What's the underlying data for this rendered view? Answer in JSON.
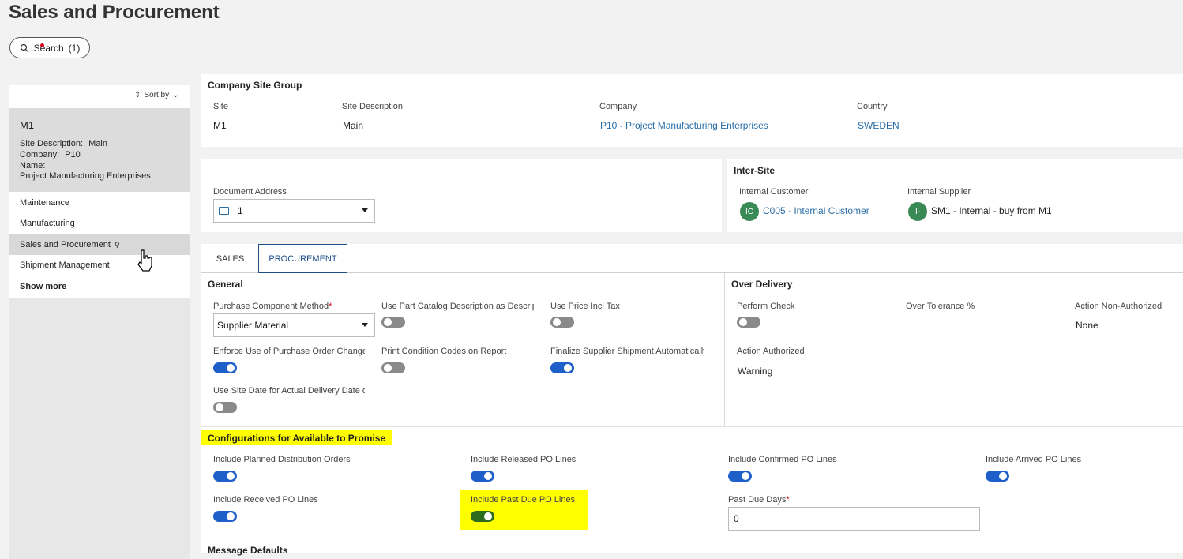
{
  "page": {
    "title": "Sales and Procurement"
  },
  "search": {
    "label": "Search",
    "count": "(1)"
  },
  "sidebar": {
    "sort_label": "Sort by",
    "selected": {
      "code": "M1",
      "site_description_label": "Site Description:",
      "site_description": "Main",
      "company_label": "Company:",
      "company": "P10",
      "name_label": "Name:",
      "name": "Project Manufacturing Enterprises"
    },
    "items": [
      {
        "label": "Maintenance"
      },
      {
        "label": "Manufacturing"
      },
      {
        "label": "Sales and Procurement"
      },
      {
        "label": "Shipment Management"
      }
    ],
    "show_more": "Show more"
  },
  "company_site_group": {
    "title": "Company Site Group",
    "site_label": "Site",
    "site": "M1",
    "site_desc_label": "Site Description",
    "site_desc": "Main",
    "company_label": "Company",
    "company": "P10 - Project Manufacturing Enterprises",
    "country_label": "Country",
    "country": "SWEDEN"
  },
  "document_address": {
    "label": "Document Address",
    "value": "1"
  },
  "inter_site": {
    "title": "Inter-Site",
    "customer_label": "Internal Customer",
    "customer_avatar": "IC",
    "customer": "C005 - Internal Customer",
    "supplier_label": "Internal Supplier",
    "supplier_avatar": "I-",
    "supplier": "SM1 - Internal - buy from M1"
  },
  "tabs": [
    {
      "label": "SALES"
    },
    {
      "label": "PROCUREMENT"
    }
  ],
  "general": {
    "title": "General",
    "purchase_component_method_label": "Purchase Component Method",
    "purchase_component_method": "Supplier Material",
    "use_part_catalog_label": "Use Part Catalog Description as Descripti",
    "use_price_incl_tax_label": "Use Price Incl Tax",
    "enforce_po_change_label": "Enforce Use of Purchase Order Change (",
    "print_condition_codes_label": "Print Condition Codes on Report",
    "finalize_supplier_shipment_label": "Finalize Supplier Shipment Automatically",
    "use_site_date_label": "Use Site Date for Actual Delivery Date or"
  },
  "over_delivery": {
    "title": "Over Delivery",
    "perform_check_label": "Perform Check",
    "over_tolerance_label": "Over Tolerance %",
    "action_non_auth_label": "Action Non-Authorized",
    "action_non_auth": "None",
    "action_auth_label": "Action Authorized",
    "action_auth": "Warning"
  },
  "atp": {
    "title": "Configurations for Available to Promise",
    "planned_distribution_label": "Include Planned Distribution Orders",
    "released_po_label": "Include Released PO Lines",
    "confirmed_po_label": "Include Confirmed PO Lines",
    "arrived_po_label": "Include Arrived PO Lines",
    "received_po_label": "Include Received PO Lines",
    "past_due_po_label": "Include Past Due PO Lines",
    "past_due_days_label": "Past Due Days",
    "past_due_days": "0"
  },
  "message_defaults": {
    "title": "Message Defaults"
  },
  "colors": {
    "accent": "#1e5fc9",
    "link": "#2a6ea7",
    "highlight": "#ffff00",
    "required": "#d0021b"
  }
}
